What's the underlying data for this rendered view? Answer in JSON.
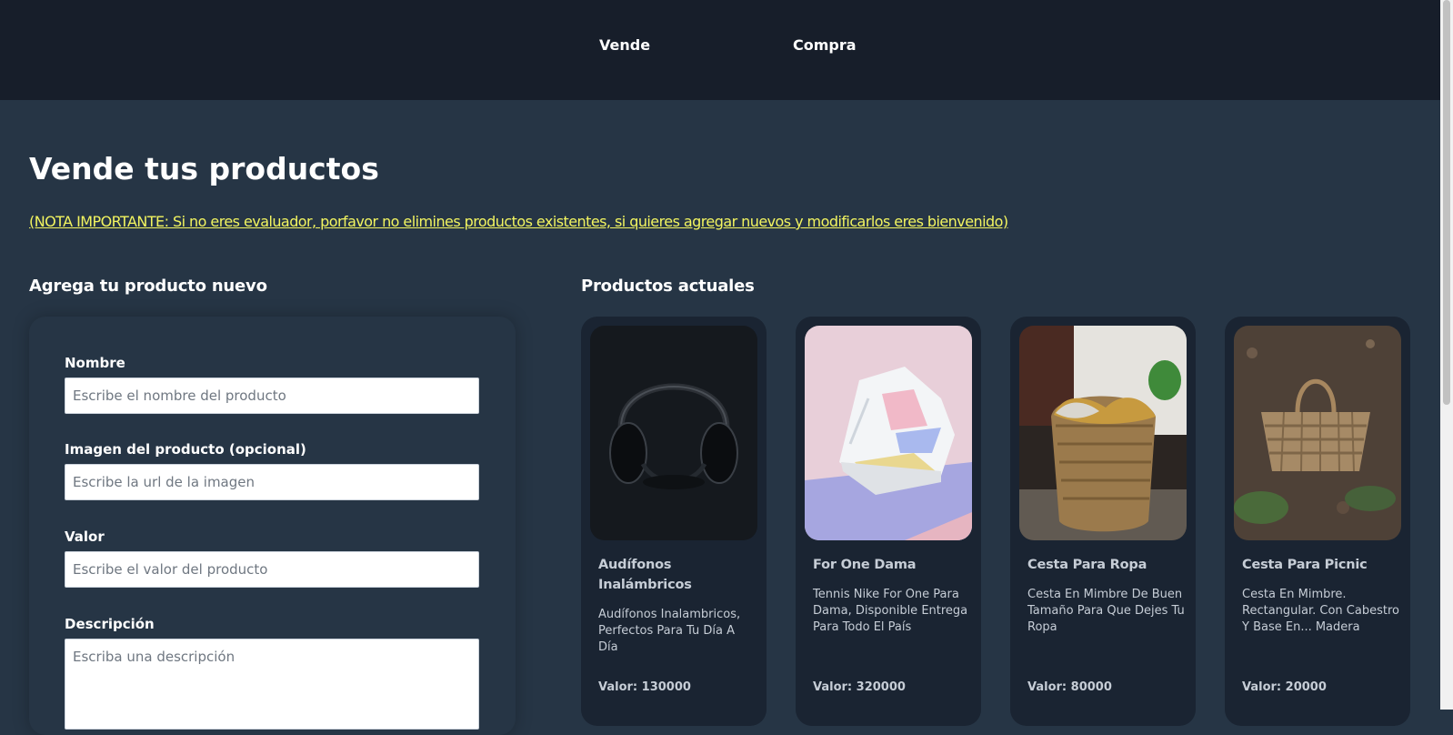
{
  "nav": {
    "sell_label": "Vende",
    "buy_label": "Compra"
  },
  "page": {
    "title": "Vende tus productos",
    "note": "(NOTA IMPORTANTE: Si no eres evaluador, porfavor no elimines productos existentes, si quieres agregar nuevos y modificarlos eres bienvenido)"
  },
  "form": {
    "title": "Agrega tu producto nuevo",
    "name_label": "Nombre",
    "name_placeholder": "Escribe el nombre del producto",
    "image_label": "Imagen del producto (opcional)",
    "image_placeholder": "Escribe la url de la imagen",
    "value_label": "Valor",
    "value_placeholder": "Escribe el valor del producto",
    "description_label": "Descripción",
    "description_placeholder": "Escriba una descripción"
  },
  "products": {
    "title": "Productos actuales",
    "items": [
      {
        "name": "Audífonos Inalámbricos",
        "description": "Audífonos Inalambricos, Perfectos Para Tu Día A Día",
        "value": "Valor: 130000",
        "image": "headphones"
      },
      {
        "name": "For One Dama",
        "description": "Tennis Nike For One Para Dama, Disponible Entrega Para Todo El País",
        "value": "Valor: 320000",
        "image": "sneaker"
      },
      {
        "name": "Cesta Para Ropa",
        "description": "Cesta En Mimbre De Buen Tamaño Para Que Dejes Tu Ropa",
        "value": "Valor: 80000",
        "image": "laundry-basket"
      },
      {
        "name": "Cesta Para Picnic",
        "description": "Cesta En Mimbre. Rectangular. Con Cabestro Y Base En... Madera",
        "value": "Valor: 20000",
        "image": "picnic-basket"
      }
    ]
  }
}
